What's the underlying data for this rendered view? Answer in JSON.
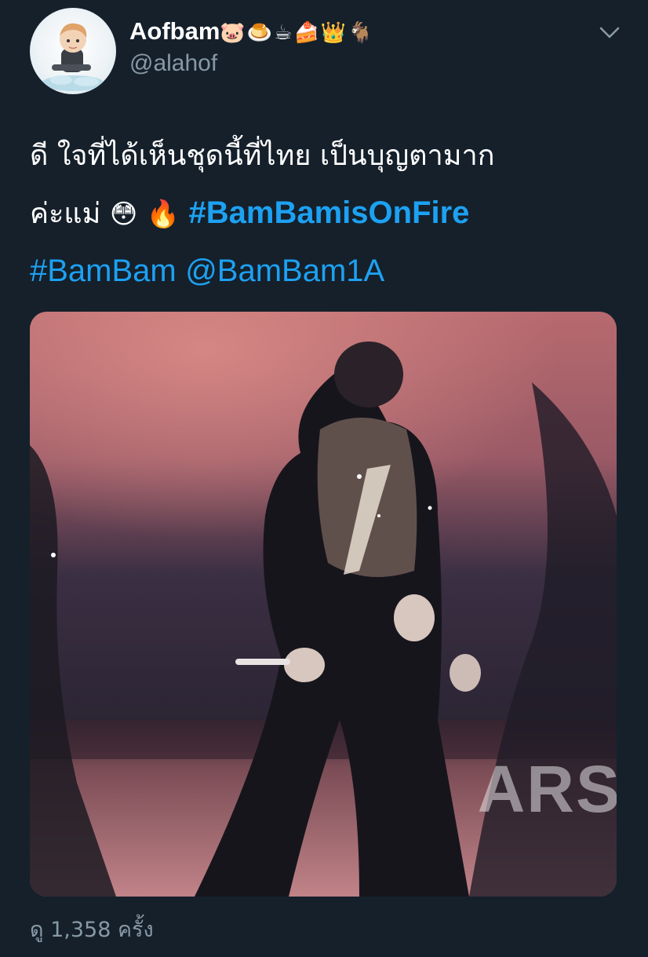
{
  "author": {
    "display_name": "Aofbam",
    "name_emojis": "🐷🍮☕🍰👑🐐",
    "username": "@alahof",
    "avatar_icon": "cartoon-avatar-icon"
  },
  "menu": {
    "icon": "chevron-down-icon"
  },
  "tweet": {
    "line1": "ดี ใจที่ได้เห็นชุดนี้ที่ไทย เป็นบุญตามาก",
    "line2_text": "ค่ะแม่",
    "line2_emoji1": "😳",
    "line2_emoji2": "🔥",
    "hashtag_main": "#BamBamisOnFire",
    "hashtag_secondary": "#BamBam",
    "mention": "@BamBam1A"
  },
  "media": {
    "type": "video",
    "watermark": "ARS"
  },
  "footer": {
    "view_count": "ดู 1,358 ครั้ง"
  },
  "colors": {
    "background": "#15202b",
    "link": "#1da1f2",
    "secondary_text": "#8899a6"
  }
}
